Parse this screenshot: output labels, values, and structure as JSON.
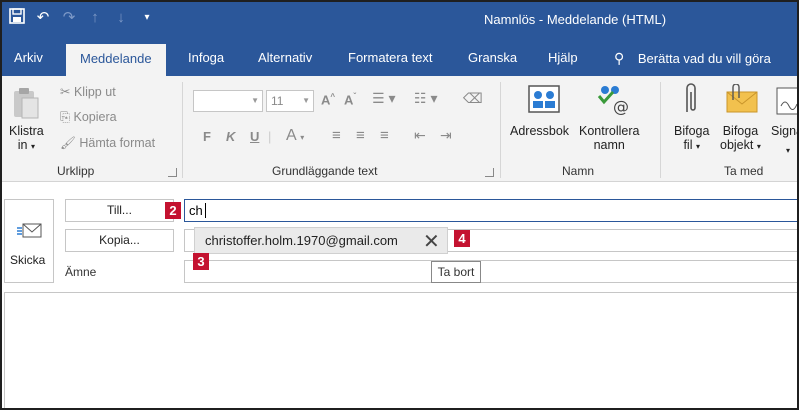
{
  "window": {
    "title": "Namnlös - Meddelande (HTML)"
  },
  "tabs": [
    {
      "label": "Arkiv"
    },
    {
      "label": "Meddelande"
    },
    {
      "label": "Infoga"
    },
    {
      "label": "Alternativ"
    },
    {
      "label": "Formatera text"
    },
    {
      "label": "Granska"
    },
    {
      "label": "Hjälp"
    },
    {
      "label": "Berätta vad du vill göra"
    }
  ],
  "ribbon": {
    "clipboard": {
      "paste_line1": "Klistra",
      "paste_line2": "in",
      "cut": "Klipp ut",
      "copy": "Kopiera",
      "format_painter": "Hämta format",
      "group": "Urklipp"
    },
    "basic_text": {
      "font_size": "11",
      "bold": "F",
      "italic": "K",
      "underline": "U",
      "group": "Grundläggande text"
    },
    "names": {
      "address_book": "Adressbok",
      "check_names_line1": "Kontrollera",
      "check_names_line2": "namn",
      "group": "Namn"
    },
    "include": {
      "attach_file_line1": "Bifoga",
      "attach_file_line2": "fil",
      "attach_item_line1": "Bifoga",
      "attach_item_line2": "objekt",
      "signature": "Signa",
      "group": "Ta med"
    }
  },
  "compose": {
    "send_label": "Skicka",
    "to_button": "Till...",
    "cc_button": "Kopia...",
    "subject_label": "Ämne",
    "to_value": "ch",
    "autocomplete_suggestion": "christoffer.holm.1970@gmail.com",
    "tooltip": "Ta bort"
  },
  "markers": {
    "m2": "2",
    "m3": "3",
    "m4": "4"
  }
}
